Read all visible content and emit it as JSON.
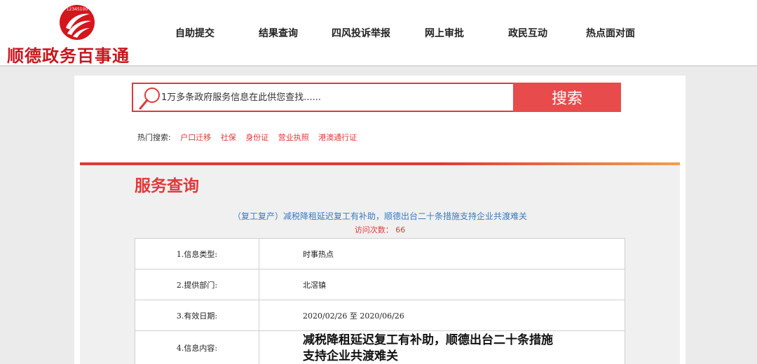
{
  "brand": {
    "name": "顺德政务百事通",
    "emblem_text": "12345100",
    "logo_icon": "red-swirl-emblem"
  },
  "nav": {
    "items": [
      "自助提交",
      "结果查询",
      "四风投诉举报",
      "网上审批",
      "政民互动",
      "热点面对面"
    ]
  },
  "search": {
    "placeholder": "1万多条政府服务信息在此供您查找......",
    "value": "",
    "button_label": "搜索",
    "icon": "magnifier-icon"
  },
  "hot_search": {
    "label": "热门搜索:",
    "links": [
      "户口迁移",
      "社保",
      "身份证",
      "营业执照",
      "港澳通行证"
    ]
  },
  "service": {
    "section_title": "服务查询",
    "article_title": "（复工复产）减税降租延迟复工有补助，顺德出台二十条措施支持企业共渡难关",
    "visits_label": "访问次数：",
    "visits_count": "66",
    "rows": [
      {
        "label": "1.信息类型:",
        "value": "时事热点"
      },
      {
        "label": "2.提供部门:",
        "value": "北滘镇"
      },
      {
        "label": "3.有效日期:",
        "value": "2020/02/26 至 2020/06/26"
      },
      {
        "label": "4.信息内容:",
        "value_line1": "减税降租延迟复工有补助，顺德出台二十条措施",
        "value_line2": "支持企业共渡难关"
      }
    ]
  },
  "colors": {
    "accent_red": "#e0393a",
    "search_button": "#e84b4b",
    "link_blue": "#3a7bbf",
    "page_bg": "#ebebeb"
  }
}
